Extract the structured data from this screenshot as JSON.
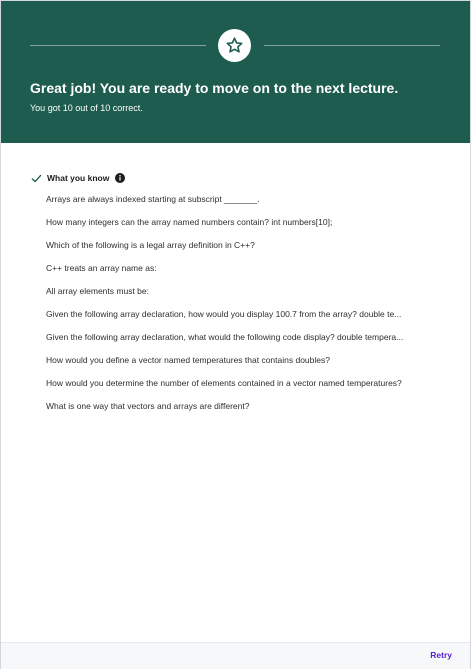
{
  "colors": {
    "hero_background": "#1e5c4f",
    "check": "#1e6055",
    "link": "#5624d0"
  },
  "hero": {
    "icon": "star-icon",
    "title": "Great job! You are ready to move on to the next lecture.",
    "subtitle": "You got 10 out of 10 correct."
  },
  "results": {
    "check_icon": "check-icon",
    "info_icon": "info-icon",
    "section_title": "What you know",
    "questions": [
      "Arrays are always indexed starting at subscript _______.",
      "How many integers can the array named numbers contain? int numbers[10];",
      "Which of the following is a legal array definition in C++?",
      "C++ treats an array name as:",
      "All array elements must be:",
      "Given the following array declaration, how would you display 100.7  from the array? double te...",
      "Given the following array declaration, what would the following code display?  double tempera...",
      "How would you define a vector named temperatures that contains doubles?",
      "How would you determine the number of elements contained in a vector named temperatures?",
      "What is one way that vectors and arrays are different?"
    ]
  },
  "footer": {
    "retry_label": "Retry"
  }
}
